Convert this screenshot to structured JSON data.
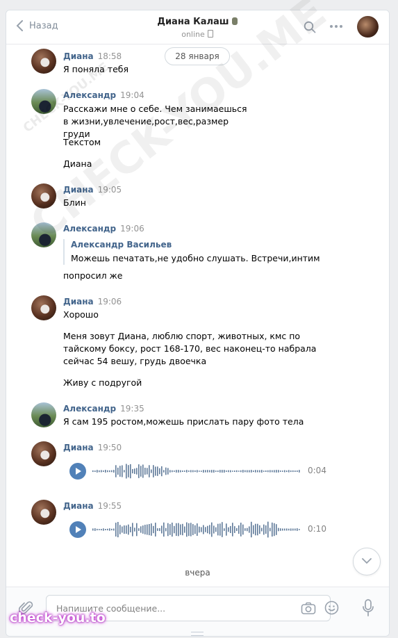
{
  "header": {
    "back_label": "Назад",
    "title": "Диана Калаш",
    "status": "online"
  },
  "date_pill": "28 января",
  "messages": [
    {
      "author": "Диана",
      "time": "18:58",
      "lines": [
        "Я поняла тебя"
      ]
    },
    {
      "author": "Александр",
      "time": "19:04",
      "lines": [
        "Расскажи мне о себе. Чем занимаешься в жизни,увлечение,рост,вес,размер груди",
        "Текстом",
        "Диана"
      ]
    },
    {
      "author": "Диана",
      "time": "19:05",
      "lines": [
        "Блин"
      ]
    },
    {
      "author": "Александр",
      "time": "19:06",
      "quote": {
        "name": "Александр Васильев",
        "text": "Можешь печатать,не удобно слушать. Встречи,интим"
      },
      "lines": [
        "попросил же"
      ]
    },
    {
      "author": "Диана",
      "time": "19:06",
      "lines": [
        "Хорошо",
        "Меня зовут Диана, люблю спорт, животных, кмс по тайскому боксу, рост 168-170, вес наконец-то набрала сейчас 54 вешу, грудь двоечка",
        "Живу с подругой"
      ]
    },
    {
      "author": "Александр",
      "time": "19:35",
      "lines": [
        "Я сам 195 ростом,можешь прислать пару фото тела"
      ]
    },
    {
      "author": "Диана",
      "time": "19:50",
      "voice": {
        "duration": "0:04"
      }
    },
    {
      "author": "Диана",
      "time": "19:55",
      "voice": {
        "duration": "0:10"
      }
    }
  ],
  "day_divider": "вчера",
  "composer": {
    "placeholder": "Напишите сообщение..."
  },
  "watermarks": {
    "diagonal": "CHECK-YOU.ME",
    "badge": "check-you.to"
  },
  "colors": {
    "link": "#42648b",
    "accent": "#5181b8",
    "background": "#edeef0"
  }
}
